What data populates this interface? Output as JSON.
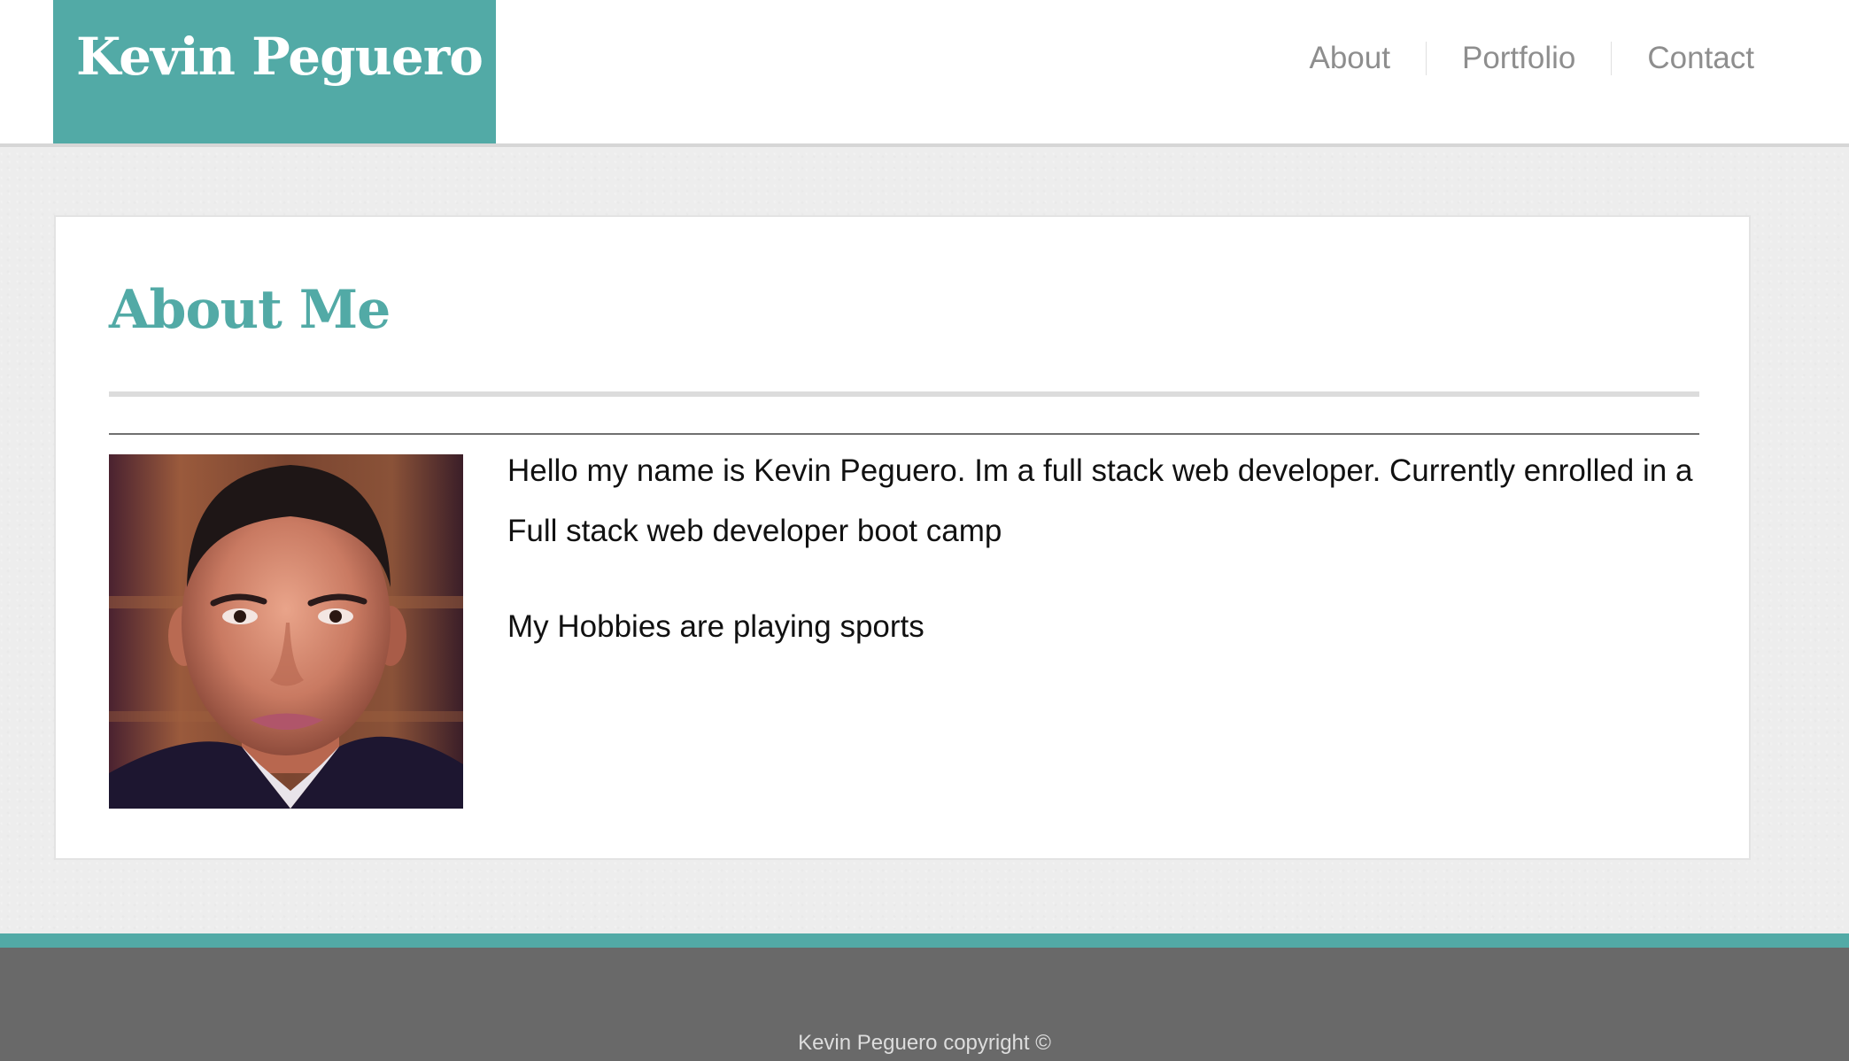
{
  "header": {
    "logo_text": "Kevin Peguero",
    "nav": [
      {
        "label": "About"
      },
      {
        "label": "Portfolio"
      },
      {
        "label": "Contact"
      }
    ]
  },
  "main": {
    "title": "About Me",
    "paragraphs": [
      "Hello my name is Kevin Peguero. Im a full stack web developer. Currently enrolled in a Full stack web developer boot camp",
      "My Hobbies are playing sports"
    ]
  },
  "footer": {
    "copyright": "Kevin Peguero copyright ©"
  },
  "colors": {
    "accent": "#52aaa6",
    "footer_bg": "#696969",
    "nav_text": "#8e8e8e",
    "page_bg": "#ededed"
  }
}
